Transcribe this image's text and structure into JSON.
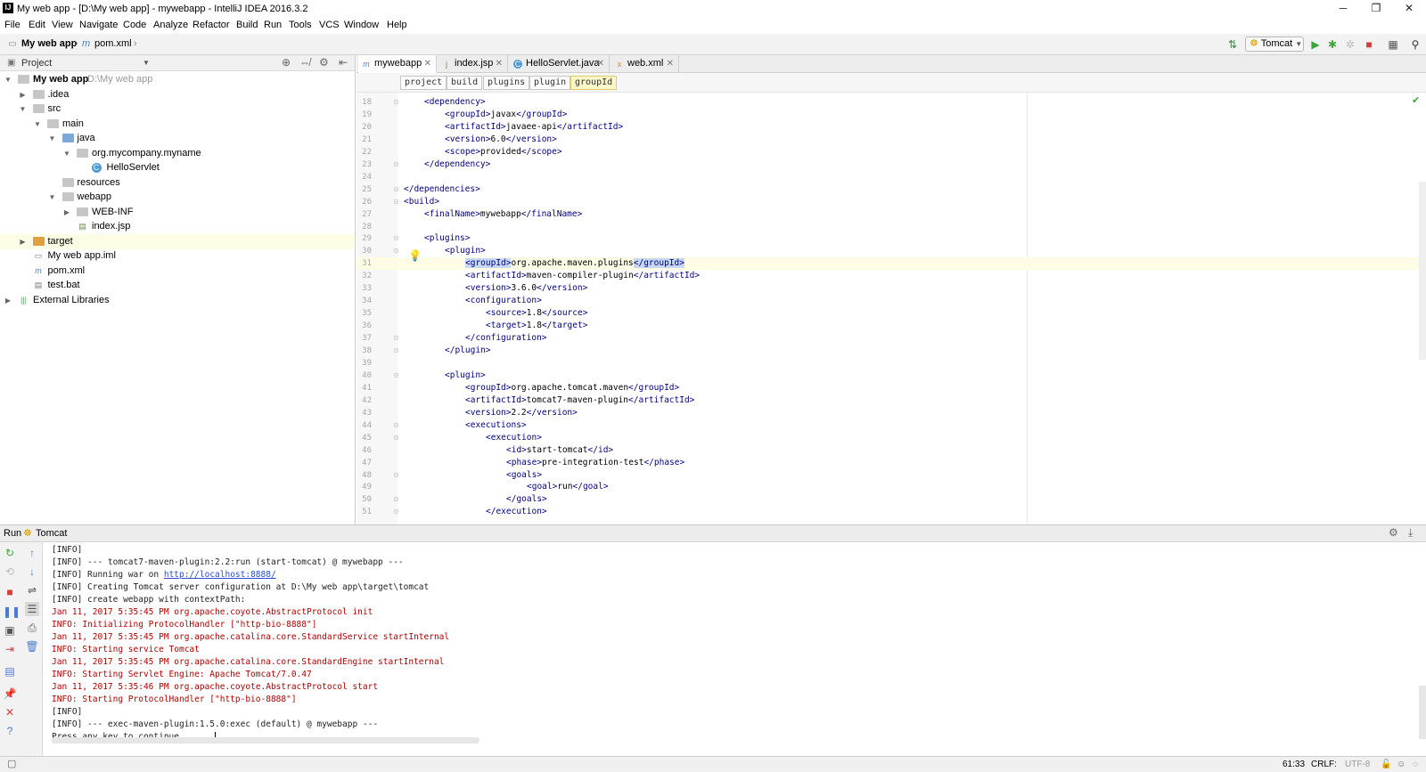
{
  "window": {
    "title": "My web app - [D:\\My web app] - mywebapp - IntelliJ IDEA 2016.3.2",
    "minimize": "─",
    "restore": "❐",
    "close": "✕"
  },
  "menu": [
    "File",
    "Edit",
    "View",
    "Navigate",
    "Code",
    "Analyze",
    "Refactor",
    "Build",
    "Run",
    "Tools",
    "VCS",
    "Window",
    "Help"
  ],
  "navbar": {
    "project": "My web app",
    "file": "pom.xml",
    "run_config": "Tomcat"
  },
  "project_panel": {
    "header": "Project",
    "tree": [
      {
        "label": "My web app",
        "hint": "D:\\My web app",
        "depth": 0,
        "expanded": true,
        "kind": "module",
        "bold": true
      },
      {
        "label": ".idea",
        "depth": 1,
        "expanded": false,
        "kind": "folder"
      },
      {
        "label": "src",
        "depth": 1,
        "expanded": true,
        "kind": "folder"
      },
      {
        "label": "main",
        "depth": 2,
        "expanded": true,
        "kind": "folder"
      },
      {
        "label": "java",
        "depth": 3,
        "expanded": true,
        "kind": "folder-blue"
      },
      {
        "label": "org.mycompany.myname",
        "depth": 4,
        "expanded": true,
        "kind": "package"
      },
      {
        "label": "HelloServlet",
        "depth": 5,
        "kind": "class"
      },
      {
        "label": "resources",
        "depth": 3,
        "kind": "folder"
      },
      {
        "label": "webapp",
        "depth": 3,
        "expanded": true,
        "kind": "folder"
      },
      {
        "label": "WEB-INF",
        "depth": 4,
        "expanded": false,
        "kind": "folder"
      },
      {
        "label": "index.jsp",
        "depth": 4,
        "kind": "jsp"
      },
      {
        "label": "target",
        "depth": 1,
        "expanded": false,
        "kind": "folder-orange",
        "highlight": true
      },
      {
        "label": "My web app.iml",
        "depth": 1,
        "kind": "iml"
      },
      {
        "label": "pom.xml",
        "depth": 1,
        "kind": "maven"
      },
      {
        "label": "test.bat",
        "depth": 1,
        "kind": "bat"
      },
      {
        "label": "External Libraries",
        "depth": 0,
        "expanded": false,
        "kind": "libs"
      }
    ]
  },
  "editor": {
    "tabs": [
      {
        "label": "mywebapp",
        "icon": "m",
        "active": true
      },
      {
        "label": "index.jsp",
        "icon": "j",
        "active": false
      },
      {
        "label": "HelloServlet.java",
        "icon": "C",
        "active": false
      },
      {
        "label": "web.xml",
        "icon": "x",
        "active": false
      }
    ],
    "breadcrumbs": [
      "project",
      "build",
      "plugins",
      "plugin",
      "groupId"
    ],
    "lines": [
      {
        "n": "18",
        "indent": 2,
        "parts": [
          [
            "t",
            "<dependency>"
          ]
        ]
      },
      {
        "n": "19",
        "indent": 3,
        "parts": [
          [
            "t",
            "<groupId>"
          ],
          [
            "x",
            "javax"
          ],
          [
            "t",
            "</groupId>"
          ]
        ]
      },
      {
        "n": "20",
        "indent": 3,
        "parts": [
          [
            "t",
            "<artifactId>"
          ],
          [
            "x",
            "javaee-api"
          ],
          [
            "t",
            "</artifactId>"
          ]
        ]
      },
      {
        "n": "21",
        "indent": 3,
        "parts": [
          [
            "t",
            "<version>"
          ],
          [
            "x",
            "6.0"
          ],
          [
            "t",
            "</version>"
          ]
        ]
      },
      {
        "n": "22",
        "indent": 3,
        "parts": [
          [
            "t",
            "<scope>"
          ],
          [
            "x",
            "provided"
          ],
          [
            "t",
            "</scope>"
          ]
        ]
      },
      {
        "n": "23",
        "indent": 2,
        "parts": [
          [
            "t",
            "</dependency>"
          ]
        ]
      },
      {
        "n": "24",
        "indent": 0,
        "parts": []
      },
      {
        "n": "25",
        "indent": 1,
        "parts": [
          [
            "t",
            "</dependencies>"
          ]
        ]
      },
      {
        "n": "26",
        "indent": 1,
        "parts": [
          [
            "t",
            "<build>"
          ]
        ]
      },
      {
        "n": "27",
        "indent": 2,
        "parts": [
          [
            "t",
            "<finalName>"
          ],
          [
            "x",
            "mywebapp"
          ],
          [
            "t",
            "</finalName>"
          ]
        ]
      },
      {
        "n": "28",
        "indent": 0,
        "parts": []
      },
      {
        "n": "29",
        "indent": 2,
        "parts": [
          [
            "t",
            "<plugins>"
          ]
        ]
      },
      {
        "n": "30",
        "indent": 3,
        "parts": [
          [
            "t",
            "<plugin>"
          ]
        ]
      },
      {
        "n": "31",
        "indent": 4,
        "parts": [
          [
            "h",
            "<groupId>"
          ],
          [
            "x",
            "org.apache.maven.plugins"
          ],
          [
            "h",
            "</groupId>"
          ]
        ],
        "current": true
      },
      {
        "n": "32",
        "indent": 4,
        "parts": [
          [
            "t",
            "<artifactId>"
          ],
          [
            "x",
            "maven-compiler-plugin"
          ],
          [
            "t",
            "</artifactId>"
          ]
        ]
      },
      {
        "n": "33",
        "indent": 4,
        "parts": [
          [
            "t",
            "<version>"
          ],
          [
            "x",
            "3.6.0"
          ],
          [
            "t",
            "</version>"
          ]
        ]
      },
      {
        "n": "34",
        "indent": 4,
        "parts": [
          [
            "t",
            "<configuration>"
          ]
        ]
      },
      {
        "n": "35",
        "indent": 5,
        "parts": [
          [
            "t",
            "<source>"
          ],
          [
            "x",
            "1.8"
          ],
          [
            "t",
            "</source>"
          ]
        ]
      },
      {
        "n": "36",
        "indent": 5,
        "parts": [
          [
            "t",
            "<target>"
          ],
          [
            "x",
            "1.8"
          ],
          [
            "t",
            "</target>"
          ]
        ]
      },
      {
        "n": "37",
        "indent": 4,
        "parts": [
          [
            "t",
            "</configuration>"
          ]
        ]
      },
      {
        "n": "38",
        "indent": 3,
        "parts": [
          [
            "t",
            "</plugin>"
          ]
        ]
      },
      {
        "n": "39",
        "indent": 0,
        "parts": []
      },
      {
        "n": "40",
        "indent": 3,
        "parts": [
          [
            "t",
            "<plugin>"
          ]
        ]
      },
      {
        "n": "41",
        "indent": 4,
        "parts": [
          [
            "t",
            "<groupId>"
          ],
          [
            "x",
            "org.apache.tomcat.maven"
          ],
          [
            "t",
            "</groupId>"
          ]
        ]
      },
      {
        "n": "42",
        "indent": 4,
        "parts": [
          [
            "t",
            "<artifactId>"
          ],
          [
            "x",
            "tomcat7-maven-plugin"
          ],
          [
            "t",
            "</artifactId>"
          ]
        ]
      },
      {
        "n": "43",
        "indent": 4,
        "parts": [
          [
            "t",
            "<version>"
          ],
          [
            "x",
            "2.2"
          ],
          [
            "t",
            "</version>"
          ]
        ]
      },
      {
        "n": "44",
        "indent": 4,
        "parts": [
          [
            "t",
            "<executions>"
          ]
        ]
      },
      {
        "n": "45",
        "indent": 5,
        "parts": [
          [
            "t",
            "<execution>"
          ]
        ]
      },
      {
        "n": "46",
        "indent": 6,
        "parts": [
          [
            "t",
            "<id>"
          ],
          [
            "x",
            "start-tomcat"
          ],
          [
            "t",
            "</id>"
          ]
        ]
      },
      {
        "n": "47",
        "indent": 6,
        "parts": [
          [
            "t",
            "<phase>"
          ],
          [
            "x",
            "pre-integration-test"
          ],
          [
            "t",
            "</phase>"
          ]
        ]
      },
      {
        "n": "48",
        "indent": 6,
        "parts": [
          [
            "t",
            "<goals>"
          ]
        ]
      },
      {
        "n": "49",
        "indent": 7,
        "parts": [
          [
            "t",
            "<goal>"
          ],
          [
            "x",
            "run"
          ],
          [
            "t",
            "</goal>"
          ]
        ]
      },
      {
        "n": "50",
        "indent": 6,
        "parts": [
          [
            "t",
            "</goals>"
          ]
        ]
      },
      {
        "n": "51",
        "indent": 5,
        "parts": [
          [
            "t",
            "</execution>"
          ]
        ]
      }
    ]
  },
  "run_panel": {
    "label": "Run",
    "config": "Tomcat",
    "lines": [
      {
        "text": "[INFO]",
        "style": "info"
      },
      {
        "text": "[INFO] --- tomcat7-maven-plugin:2.2:run (start-tomcat) @ mywebapp ---",
        "style": "info"
      },
      {
        "text": "[INFO] Running war on ",
        "link": "http://localhost:8888/",
        "style": "info"
      },
      {
        "text": "[INFO] Creating Tomcat server configuration at D:\\My web app\\target\\tomcat",
        "style": "info"
      },
      {
        "text": "[INFO] create webapp with contextPath:",
        "style": "info"
      },
      {
        "text": "Jan 11, 2017 5:35:45 PM org.apache.coyote.AbstractProtocol init",
        "style": "red"
      },
      {
        "text": "INFO: Initializing ProtocolHandler [\"http-bio-8888\"]",
        "style": "red"
      },
      {
        "text": "Jan 11, 2017 5:35:45 PM org.apache.catalina.core.StandardService startInternal",
        "style": "red"
      },
      {
        "text": "INFO: Starting service Tomcat",
        "style": "red"
      },
      {
        "text": "Jan 11, 2017 5:35:45 PM org.apache.catalina.core.StandardEngine startInternal",
        "style": "red"
      },
      {
        "text": "INFO: Starting Servlet Engine: Apache Tomcat/7.0.47",
        "style": "red"
      },
      {
        "text": "Jan 11, 2017 5:35:46 PM org.apache.coyote.AbstractProtocol start",
        "style": "red"
      },
      {
        "text": "INFO: Starting ProtocolHandler [\"http-bio-8888\"]",
        "style": "red"
      },
      {
        "text": "[INFO]",
        "style": "info"
      },
      {
        "text": "[INFO] --- exec-maven-plugin:1.5.0:exec (default) @ mywebapp ---",
        "style": "info"
      },
      {
        "text": "Press any key to continue . . . ",
        "style": "info",
        "cursor": true
      }
    ]
  },
  "status": {
    "position": "61:33",
    "line_separator": "CRLF:",
    "encoding": "UTF-8"
  },
  "colors": {
    "tag": "#000080",
    "console_red": "#b10000",
    "link": "#2a4bd7",
    "current_line": "#fdfde6"
  }
}
